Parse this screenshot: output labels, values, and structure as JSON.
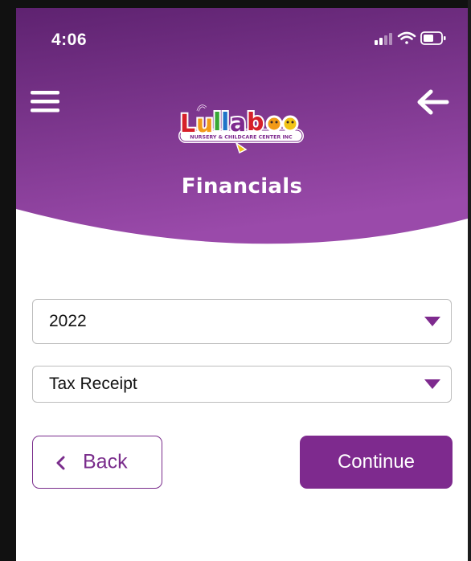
{
  "status_bar": {
    "time": "4:06"
  },
  "header": {
    "title": "Financials",
    "logo_name": "Lullaboo",
    "logo_tagline": "NURSERY & CHILDCARE CENTER INC",
    "menu_icon": "hamburger-menu-icon",
    "back_icon": "arrow-left-icon"
  },
  "form": {
    "year_select": {
      "value": "2022"
    },
    "document_select": {
      "value": "Tax Receipt"
    }
  },
  "actions": {
    "back_label": "Back",
    "continue_label": "Continue"
  },
  "colors": {
    "brand_purple": "#7e2a8e",
    "header_gradient_top": "#5e2270",
    "header_gradient_bottom": "#9a4aaa",
    "background": "#ffffff"
  }
}
